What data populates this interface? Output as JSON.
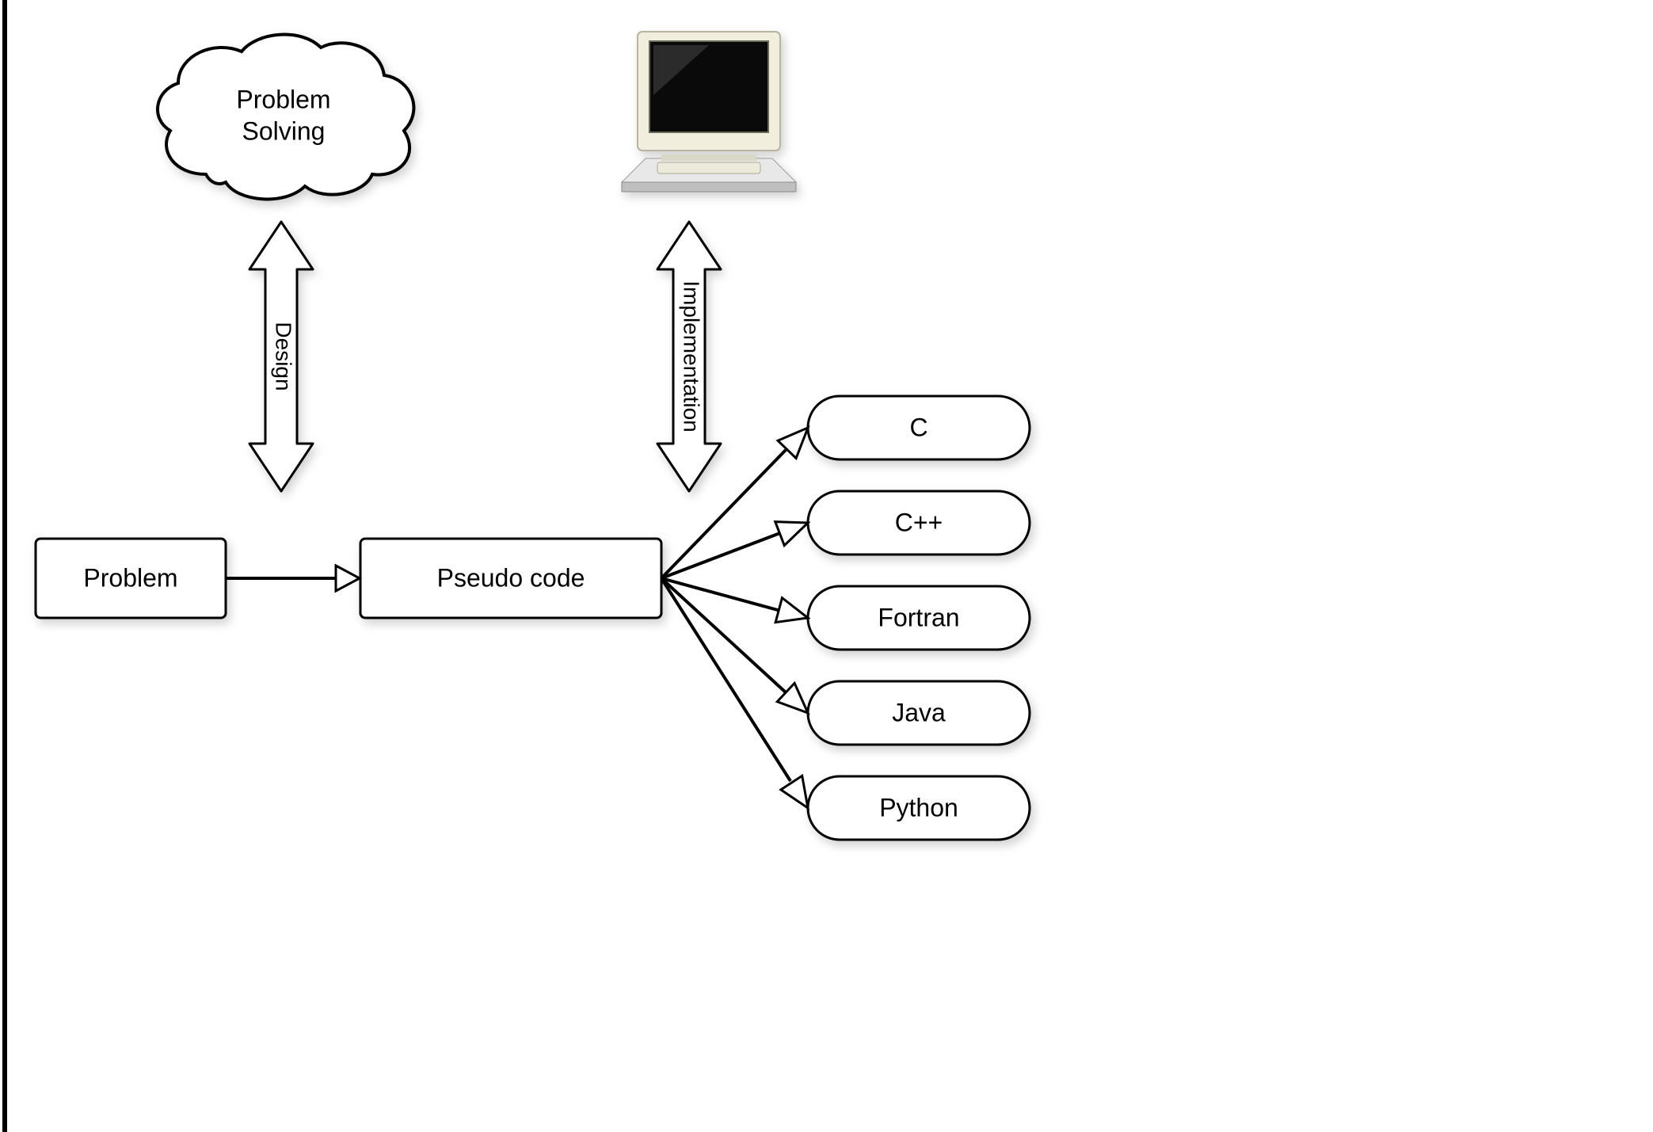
{
  "cloud": {
    "line1": "Problem",
    "line2": "Solving"
  },
  "design_label": "Design",
  "implementation_label": "Implementation",
  "problem_box": "Problem",
  "pseudo_box": "Pseudo code",
  "languages": {
    "l0": "C",
    "l1": "C++",
    "l2": "Fortran",
    "l3": "Java",
    "l4": "Python"
  },
  "icons": {
    "computer": "computer-icon"
  }
}
